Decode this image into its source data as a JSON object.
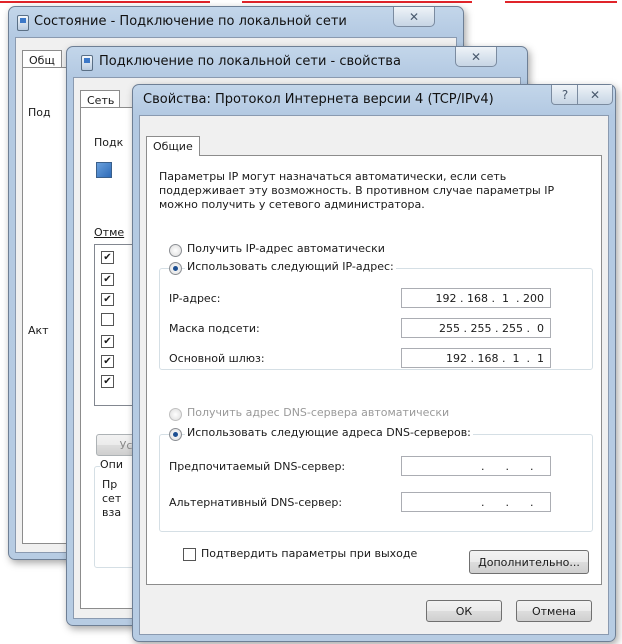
{
  "window1": {
    "title": "Состояние - Подключение по локальной сети",
    "close_glyph": "✕",
    "tab_fragment": "Общ",
    "left_fragment": "Под",
    "activity_fragment": "Акт"
  },
  "window2": {
    "title": "Подключение по локальной сети - свойства",
    "close_glyph": "✕",
    "tab_network": "Сеть",
    "connect_fragment": "Подк",
    "components_fragment": "Отме",
    "checkboxes": [
      {
        "checked": true,
        "mark": "✔"
      },
      {
        "checked": true,
        "mark": "✔"
      },
      {
        "checked": true,
        "mark": "✔"
      },
      {
        "checked": false,
        "mark": ""
      },
      {
        "checked": true,
        "mark": "✔"
      },
      {
        "checked": true,
        "mark": "✔"
      },
      {
        "checked": true,
        "mark": "✔"
      }
    ],
    "install_btn_fragment": "Ус",
    "description_group_fragment": "Опи",
    "description_lines": [
      "Пр",
      "сет",
      "вза"
    ]
  },
  "dialog": {
    "title": "Свойства: Протокол Интернета версии 4 (TCP/IPv4)",
    "help_glyph": "?",
    "close_glyph": "✕",
    "tab_general": "Общие",
    "description": "Параметры IP могут назначаться автоматически, если сеть поддерживает эту возможность. В противном случае параметры IP можно получить у сетевого администратора.",
    "ip_auto_label": "Получить IP-адрес автоматически",
    "ip_manual_label": "Использовать следующий IP-адрес:",
    "ip_auto_selected": false,
    "ip_manual_selected": true,
    "ip_address_label": "IP-адрес:",
    "ip_address_value": "192 . 168 .  1  . 200",
    "subnet_label": "Маска подсети:",
    "subnet_value": "255 . 255 . 255 .  0",
    "gateway_label": "Основной шлюз:",
    "gateway_value": "192 . 168 .  1  .  1",
    "dns_auto_label": "Получить адрес DNS-сервера автоматически",
    "dns_manual_label": "Использовать следующие адреса DNS-серверов:",
    "dns_auto_selected": false,
    "dns_manual_selected": true,
    "preferred_dns_label": "Предпочитаемый DNS-сервер:",
    "preferred_dns_value": "  .      .      .   ",
    "alternate_dns_label": "Альтернативный DNS-сервер:",
    "alternate_dns_value": "  .      .      .   ",
    "validate_label": "Подтвердить параметры при выходе",
    "validate_checked": false,
    "advanced_button": "Дополнительно...",
    "ok_button": "ОК",
    "cancel_button": "Отмена"
  },
  "colors": {
    "accent_red": "#e0242a",
    "window_frame": "#b3c9e2",
    "selected_radio": "#1d4f91"
  },
  "icons": [
    "adapter-icon",
    "close-icon",
    "help-icon",
    "network-icon"
  ]
}
